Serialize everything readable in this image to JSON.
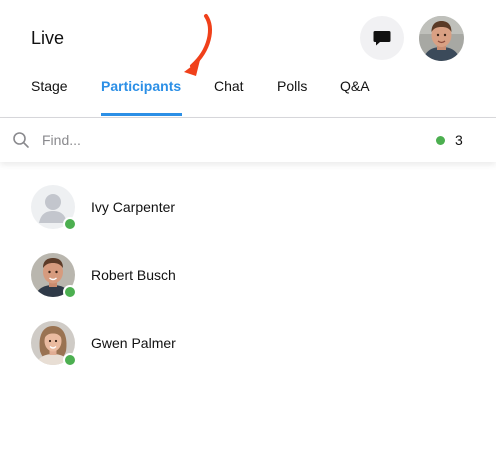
{
  "header": {
    "title": "Live"
  },
  "tabs": [
    {
      "label": "Stage",
      "active": false
    },
    {
      "label": "Participants",
      "active": true
    },
    {
      "label": "Chat",
      "active": false
    },
    {
      "label": "Polls",
      "active": false
    },
    {
      "label": "Q&A",
      "active": false
    }
  ],
  "search": {
    "placeholder": "Find...",
    "value": ""
  },
  "online": {
    "count": "3"
  },
  "participants": [
    {
      "name": "Ivy Carpenter",
      "avatar": "default-person-icon",
      "status": "online"
    },
    {
      "name": "Robert Busch",
      "avatar": "photo",
      "status": "online"
    },
    {
      "name": "Gwen Palmer",
      "avatar": "photo",
      "status": "online"
    }
  ],
  "colors": {
    "accent": "#2b8fe6",
    "online": "#4caf50",
    "arrow": "#f0401a"
  }
}
